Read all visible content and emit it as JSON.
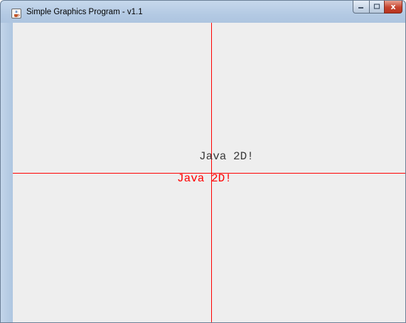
{
  "window": {
    "title": "Simple Graphics Program - v1.1",
    "icon": "java-cup-icon"
  },
  "caption_buttons": {
    "minimize_icon": "minimize-icon",
    "maximize_icon": "maximize-icon",
    "close_icon": "close-icon",
    "close_symbol": "x"
  },
  "canvas": {
    "background": "#eeeeee",
    "axis_color": "#ff0000",
    "texts": [
      {
        "text": "Java 2D!",
        "color": "#3a3a3a"
      },
      {
        "text": "Java 2D!",
        "color": "#ff0000"
      }
    ]
  }
}
